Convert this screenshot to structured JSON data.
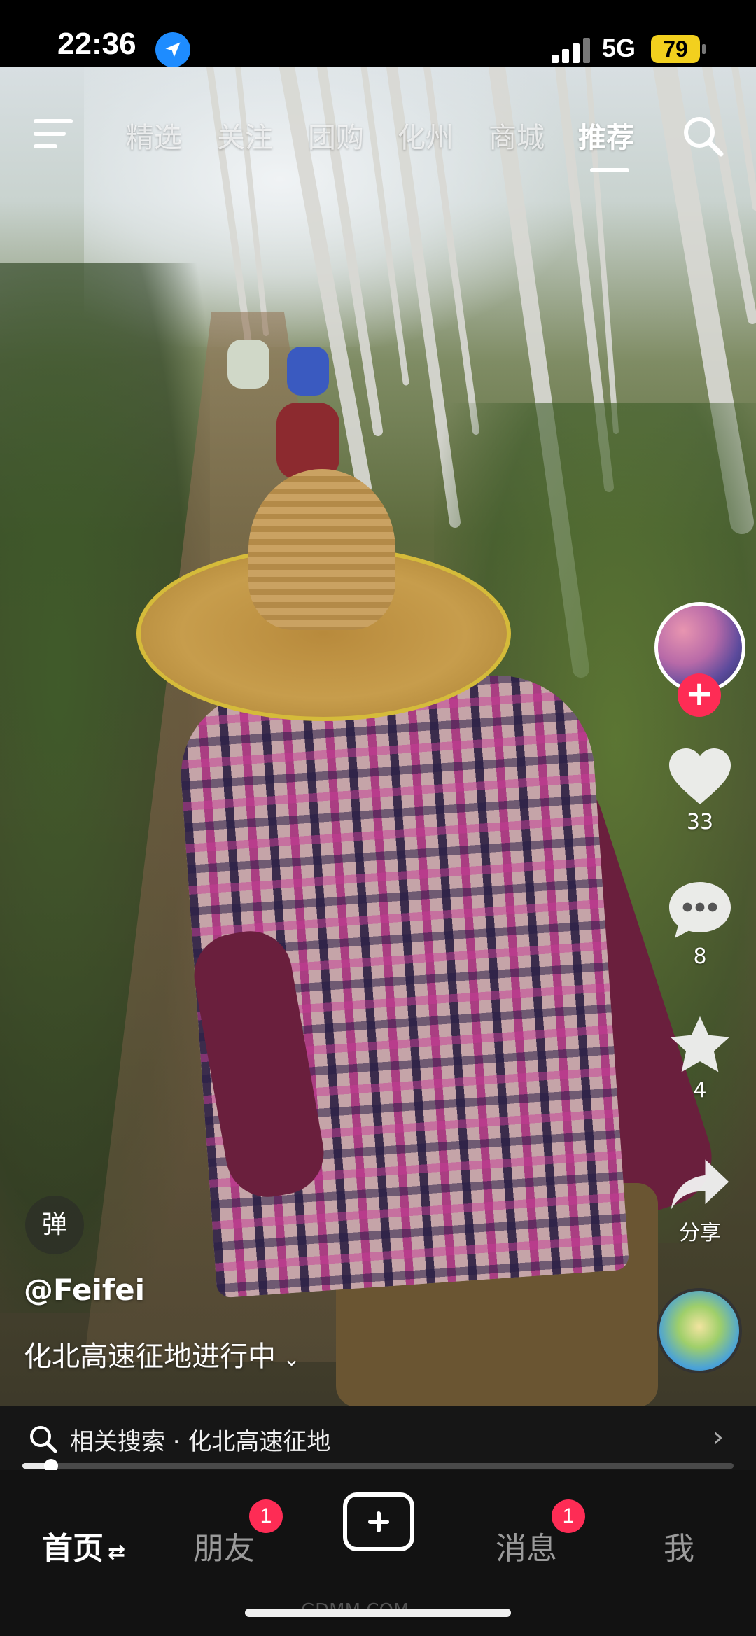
{
  "status_bar": {
    "time": "22:36",
    "network": "5G",
    "battery": "79",
    "location_icon": "location-arrow-icon",
    "signal_icon": "cellular-signal-icon"
  },
  "top_nav": {
    "menu_icon": "hamburger-menu-icon",
    "tabs": [
      {
        "label": "精选",
        "active": false
      },
      {
        "label": "关注",
        "active": false
      },
      {
        "label": "团购",
        "active": false
      },
      {
        "label": "化州",
        "active": false
      },
      {
        "label": "商城",
        "active": false
      },
      {
        "label": "推荐",
        "active": true
      }
    ],
    "search_icon": "search-icon"
  },
  "actions": {
    "follow_icon": "plus-icon",
    "like_count": "33",
    "comment_count": "8",
    "favorite_count": "4",
    "share_label": "分享"
  },
  "video": {
    "danmu_label": "弹",
    "author": "@Feifei",
    "caption": "化北高速征地进行中",
    "caption_more_icon": "chevron-down-icon",
    "progress": 0.04
  },
  "related_search": {
    "text": "相关搜索 · 化北高速征地",
    "arrow": "›"
  },
  "bottom_nav": {
    "items": [
      {
        "label": "首页",
        "active": true,
        "suffix": "⇄"
      },
      {
        "label": "朋友",
        "badge": "1"
      },
      {
        "label": "消息",
        "badge": "1"
      },
      {
        "label": "我"
      }
    ]
  },
  "watermark": "GDMM.COM",
  "colors": {
    "accent": "#fe2c55",
    "battery": "#f2d01e",
    "location": "#1e8cff"
  }
}
